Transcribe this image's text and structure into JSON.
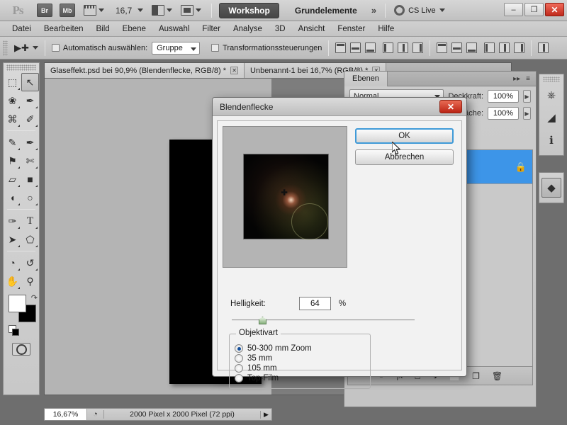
{
  "app": {
    "logo": "Ps",
    "bridge_label": "Br",
    "minibridge_label": "Mb",
    "zoom_level": "16,7",
    "workspace_active": "Workshop",
    "workspace_other": "Grundelemente",
    "overflow": "»",
    "cs_live": "CS Live",
    "win_minimize": "–",
    "win_restore": "❐",
    "win_close": "✕"
  },
  "menu": {
    "items": [
      "Datei",
      "Bearbeiten",
      "Bild",
      "Ebene",
      "Auswahl",
      "Filter",
      "Analyse",
      "3D",
      "Ansicht",
      "Fenster",
      "Hilfe"
    ]
  },
  "options_bar": {
    "auto_select_label": "Automatisch auswählen:",
    "auto_select_value": "Gruppe",
    "transform_controls_label": "Transformationssteuerungen"
  },
  "tools": {
    "items": [
      {
        "name": "marquee-tool",
        "glyph": "⬚"
      },
      {
        "name": "move-tool",
        "glyph": "↖"
      },
      {
        "name": "lasso-tool",
        "glyph": "❀"
      },
      {
        "name": "quick-select-tool",
        "glyph": "✒"
      },
      {
        "name": "crop-tool",
        "glyph": "⌘"
      },
      {
        "name": "eyedropper-tool",
        "glyph": "✐"
      },
      {
        "name": "healing-brush-tool",
        "glyph": "✎"
      },
      {
        "name": "brush-tool",
        "glyph": "✒"
      },
      {
        "name": "clone-stamp-tool",
        "glyph": "⚑"
      },
      {
        "name": "history-brush-tool",
        "glyph": "✄"
      },
      {
        "name": "eraser-tool",
        "glyph": "▱"
      },
      {
        "name": "gradient-tool",
        "glyph": "■"
      },
      {
        "name": "blur-tool",
        "glyph": "◖"
      },
      {
        "name": "dodge-tool",
        "glyph": "○"
      },
      {
        "name": "pen-tool",
        "glyph": "✑"
      },
      {
        "name": "type-tool",
        "glyph": "T"
      },
      {
        "name": "path-selection-tool",
        "glyph": "➤"
      },
      {
        "name": "shape-tool",
        "glyph": "⬠"
      },
      {
        "name": "rotate-3d-tool",
        "glyph": "◔"
      },
      {
        "name": "orbit-3d-tool",
        "glyph": "↺"
      },
      {
        "name": "hand-tool",
        "glyph": "✋"
      },
      {
        "name": "zoom-tool",
        "glyph": "⚲"
      }
    ]
  },
  "documents": {
    "tabs": [
      {
        "label": "Glaseffekt.psd bei 90,9% (Blendenflecke, RGB/8) *",
        "close": "✕",
        "active": true
      },
      {
        "label": "Unbenannt-1 bei 16,7% (RGB/8) *",
        "close": "✕",
        "active": false
      }
    ]
  },
  "layers_panel": {
    "tab_label": "Ebenen",
    "collapse": "▸▸",
    "menu": "≡",
    "blend_mode": "Normal",
    "opacity_label": "Deckkraft:",
    "opacity_value": "100%",
    "fill_label": "Fläche:",
    "fill_value": "100%",
    "layer_lock_icon": "🔒",
    "footer_icons": [
      "link-icon",
      "fx-icon",
      "mask-icon",
      "adjustment-icon",
      "group-icon",
      "new-layer-icon",
      "delete-icon"
    ],
    "footer_glyphs": [
      "⚭",
      "fx",
      "□",
      "◑",
      "⬜",
      "❐",
      "🗑"
    ]
  },
  "dock": {
    "icons": [
      {
        "name": "navigator-icon",
        "glyph": "⎈"
      },
      {
        "name": "histogram-icon",
        "glyph": "◢"
      },
      {
        "name": "info-icon",
        "glyph": "ℹ"
      }
    ],
    "layers_icon": "◆"
  },
  "status_bar": {
    "zoom": "16,67%",
    "doc_icon": "◔",
    "dimensions": "2000 Pixel x 2000 Pixel (72 ppi)",
    "arrow": "▶"
  },
  "dialog": {
    "title": "Blendenflecke",
    "close_label": "✕",
    "ok_label": "OK",
    "cancel_label": "Abbrechen",
    "brightness_label": "Helligkeit:",
    "brightness_value": "64",
    "percent_label": "%",
    "lens_legend": "Objektivart",
    "lens_options": [
      {
        "label": "50-300 mm Zoom",
        "selected": true
      },
      {
        "label": "35 mm",
        "selected": false
      },
      {
        "label": "105 mm",
        "selected": false
      },
      {
        "label": "Top-Film",
        "selected": false
      }
    ]
  },
  "colors": {
    "accent_blue": "#3d95e8",
    "focus_blue": "#3f9ad8",
    "close_red": "#bb2414",
    "canvas_gray": "#7d7d7d",
    "artboard_gray": "#b4b4b4"
  }
}
